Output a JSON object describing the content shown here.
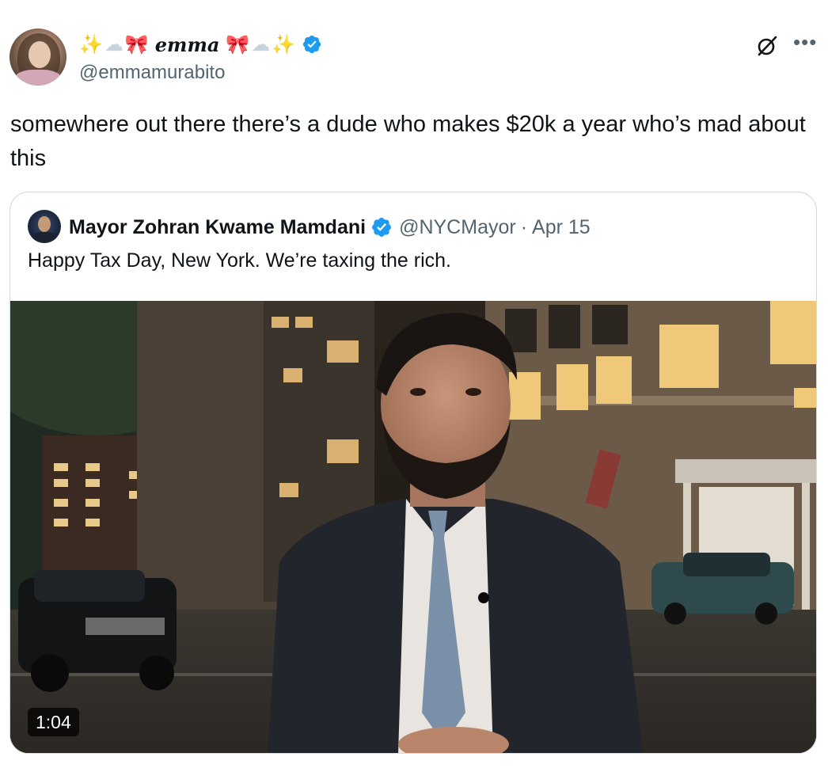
{
  "tweet": {
    "author": {
      "display_name": "emma",
      "name_emojis_left": [
        "✨",
        "☁",
        "🎀"
      ],
      "name_emojis_right": [
        "🎀",
        "☁",
        "✨"
      ],
      "handle": "@emmamurabito",
      "verified": true
    },
    "text": "somewhere out there there’s a dude who makes $20k a year who’s mad about this",
    "more_icon": "•••",
    "grok_icon": "grok-slash-icon"
  },
  "quote": {
    "author": {
      "name": "Mayor Zohran Kwame Mamdani",
      "handle": "@NYCMayor",
      "separator": "·",
      "date": "Apr 15",
      "verified": true
    },
    "text": "Happy Tax Day, New York. We’re taxing the rich.",
    "video": {
      "duration": "1:04"
    }
  },
  "colors": {
    "verified_blue": "#1d9bf0",
    "secondary_text": "#536471",
    "border": "#cfd9de"
  }
}
